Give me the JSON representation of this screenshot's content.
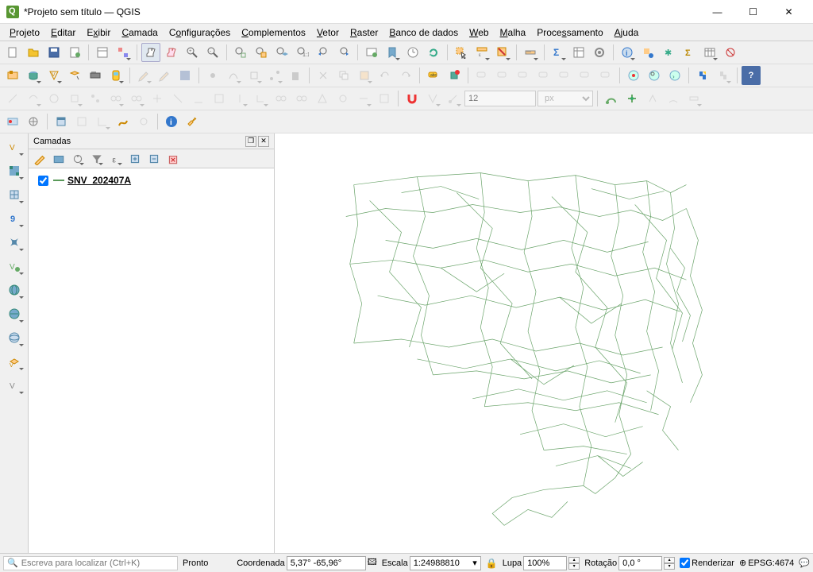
{
  "window": {
    "title": "*Projeto sem título — QGIS"
  },
  "menu": [
    "Projeto",
    "Editar",
    "Exibir",
    "Camada",
    "Configurações",
    "Complementos",
    "Vetor",
    "Raster",
    "Banco de dados",
    "Web",
    "Malha",
    "Processamento",
    "Ajuda"
  ],
  "panel": {
    "title": "Camadas",
    "layer": {
      "name": "SNV_202407A",
      "checked": true
    }
  },
  "snapping": {
    "value": "12",
    "unit": "px"
  },
  "status": {
    "search_placeholder": "Escreva para localizar (Ctrl+K)",
    "ready": "Pronto",
    "coord_label": "Coordenada",
    "coord_value": "5,37° -65,96°",
    "scale_label": "Escala",
    "scale_value": "1:24988810",
    "magnifier_label": "Lupa",
    "magnifier_value": "100%",
    "rotation_label": "Rotação",
    "rotation_value": "0,0 °",
    "render_label": "Renderizar",
    "crs": "EPSG:4674"
  }
}
